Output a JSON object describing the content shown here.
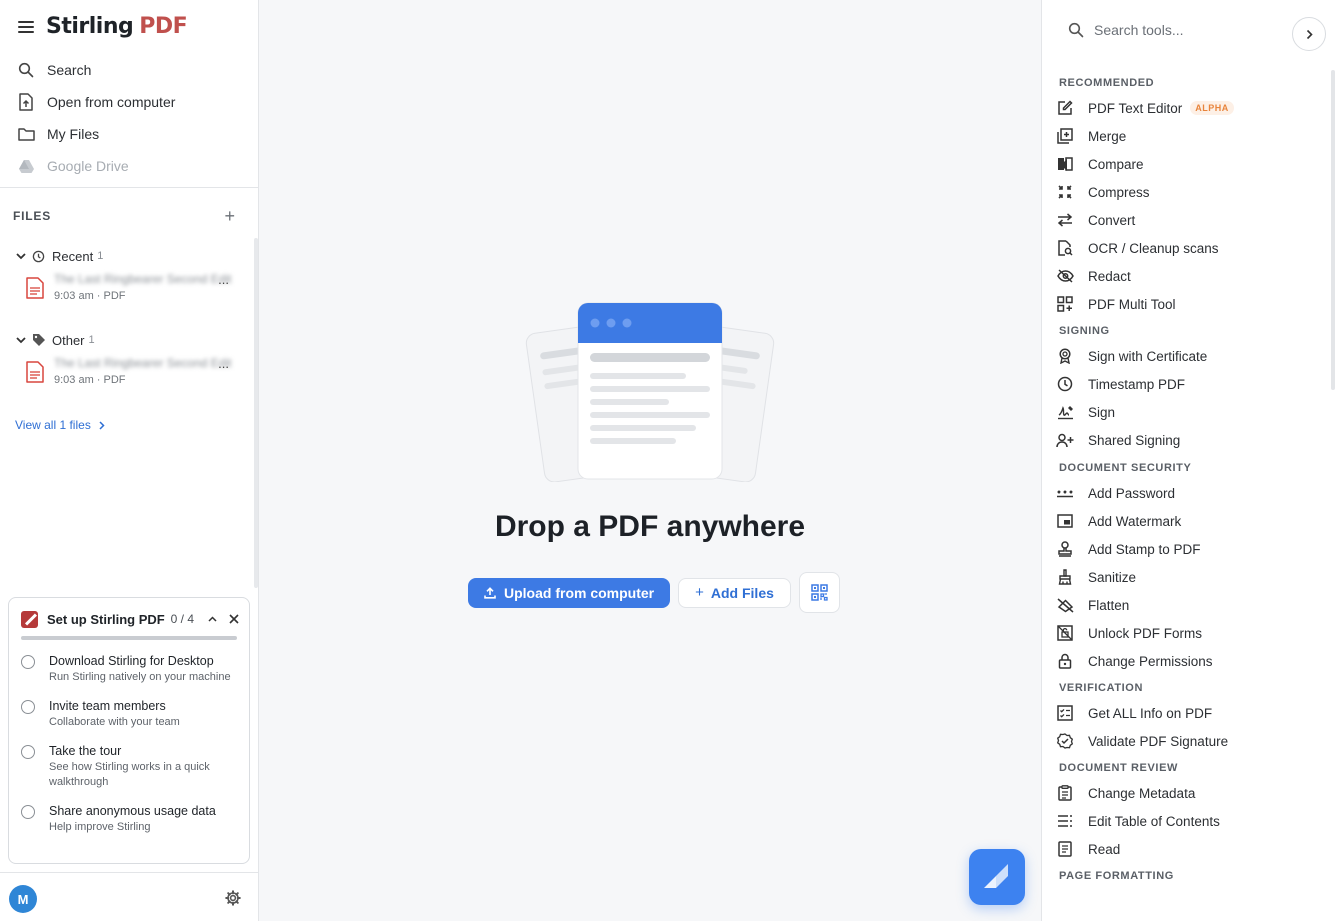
{
  "brand": {
    "name": "Stirling",
    "suffix": "PDF"
  },
  "nav": [
    {
      "label": "Search",
      "icon": "search-icon",
      "disabled": false
    },
    {
      "label": "Open from computer",
      "icon": "file-upload-icon",
      "disabled": false
    },
    {
      "label": "My Files",
      "icon": "folder-icon",
      "disabled": false
    },
    {
      "label": "Google Drive",
      "icon": "google-drive-icon",
      "disabled": true
    }
  ],
  "files": {
    "heading": "FILES",
    "groups": [
      {
        "label": "Recent",
        "count": "1",
        "file": {
          "name": "The Last Ringbearer Second Edition",
          "ellipsis": "...",
          "meta": "9:03 am · PDF"
        }
      },
      {
        "label": "Other",
        "count": "1",
        "file": {
          "name": "The Last Ringbearer Second Edition",
          "ellipsis": "...",
          "meta": "9:03 am · PDF"
        }
      }
    ],
    "view_all": "View all 1 files"
  },
  "setup": {
    "title": "Set up Stirling PDF",
    "progress_text": "0 / 4",
    "progress_fraction": 0,
    "tasks": [
      {
        "title": "Download Stirling for Desktop",
        "desc": "Run Stirling natively on your machine"
      },
      {
        "title": "Invite team members",
        "desc": "Collaborate with your team"
      },
      {
        "title": "Take the tour",
        "desc": "See how Stirling works in a quick walkthrough"
      },
      {
        "title": "Share anonymous usage data",
        "desc": "Help improve Stirling"
      }
    ]
  },
  "user": {
    "initial": "M"
  },
  "center": {
    "title": "Drop a PDF anywhere",
    "upload_label": "Upload from computer",
    "add_files_label": "Add Files"
  },
  "tools": {
    "search_placeholder": "Search tools...",
    "categories": [
      {
        "name": "RECOMMENDED",
        "items": [
          {
            "label": "PDF Text Editor",
            "icon": "edit-icon",
            "badge": "ALPHA"
          },
          {
            "label": "Merge",
            "icon": "merge-icon"
          },
          {
            "label": "Compare",
            "icon": "compare-icon"
          },
          {
            "label": "Compress",
            "icon": "compress-icon"
          },
          {
            "label": "Convert",
            "icon": "convert-icon"
          },
          {
            "label": "OCR / Cleanup scans",
            "icon": "ocr-icon"
          },
          {
            "label": "Redact",
            "icon": "redact-icon"
          },
          {
            "label": "PDF Multi Tool",
            "icon": "multi-tool-icon"
          }
        ]
      },
      {
        "name": "SIGNING",
        "items": [
          {
            "label": "Sign with Certificate",
            "icon": "certificate-icon"
          },
          {
            "label": "Timestamp PDF",
            "icon": "clock-icon"
          },
          {
            "label": "Sign",
            "icon": "signature-icon"
          },
          {
            "label": "Shared Signing",
            "icon": "shared-signing-icon"
          }
        ]
      },
      {
        "name": "DOCUMENT SECURITY",
        "items": [
          {
            "label": "Add Password",
            "icon": "password-icon"
          },
          {
            "label": "Add Watermark",
            "icon": "watermark-icon"
          },
          {
            "label": "Add Stamp to PDF",
            "icon": "stamp-icon"
          },
          {
            "label": "Sanitize",
            "icon": "sanitize-icon"
          },
          {
            "label": "Flatten",
            "icon": "flatten-icon"
          },
          {
            "label": "Unlock PDF Forms",
            "icon": "unlock-forms-icon"
          },
          {
            "label": "Change Permissions",
            "icon": "lock-icon"
          }
        ]
      },
      {
        "name": "VERIFICATION",
        "items": [
          {
            "label": "Get ALL Info on PDF",
            "icon": "info-checklist-icon"
          },
          {
            "label": "Validate PDF Signature",
            "icon": "validate-icon"
          }
        ]
      },
      {
        "name": "DOCUMENT REVIEW",
        "items": [
          {
            "label": "Change Metadata",
            "icon": "metadata-icon"
          },
          {
            "label": "Edit Table of Contents",
            "icon": "toc-icon"
          },
          {
            "label": "Read",
            "icon": "read-icon"
          }
        ]
      },
      {
        "name": "PAGE FORMATTING",
        "items": []
      }
    ]
  },
  "colors": {
    "primary": "#3d7ae4",
    "brand_red": "#c0504d",
    "alpha_badge": "#e8843c"
  }
}
